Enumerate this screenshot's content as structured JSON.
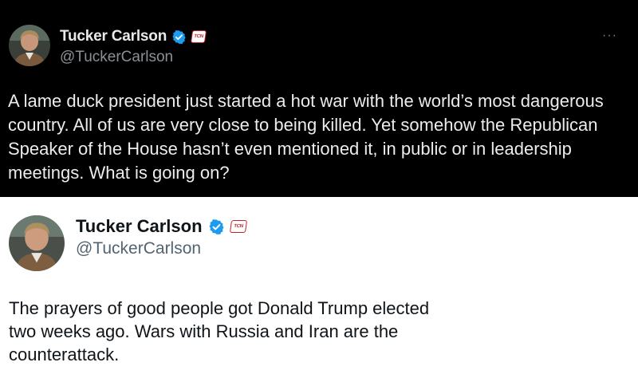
{
  "tweets": [
    {
      "name": "Tucker Carlson",
      "handle": "@TuckerCarlson",
      "more_icon": "more-dots-icon",
      "badge_text": "TCN",
      "text": "A lame duck president just started a hot war with the world’s most dangerous country. All of us are very close to being killed. Yet somehow the Republican Speaker of the House hasn’t even mentioned it, in public or in leadership meetings. What is going on?",
      "theme": "dark",
      "verified_color": "#1d9bf0"
    },
    {
      "name": "Tucker Carlson",
      "handle": "@TuckerCarlson",
      "badge_text": "TCN",
      "text": "The prayers of good people got Donald Trump elected two weeks ago. Wars with Russia and Iran are the counterattack.",
      "theme": "light",
      "verified_color": "#1d9bf0"
    }
  ]
}
